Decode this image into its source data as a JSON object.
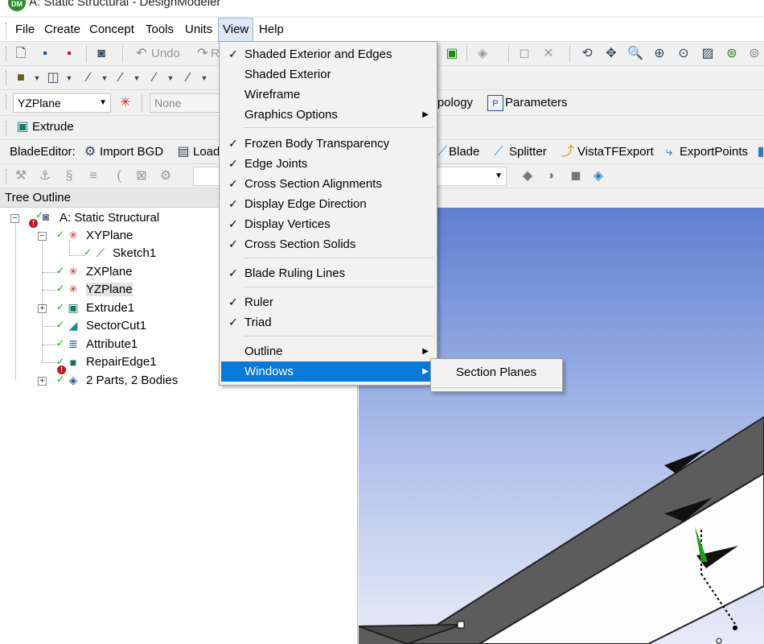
{
  "window": {
    "title": "A: Static Structural - DesignModeler",
    "app_icon": "designmodeler-icon"
  },
  "menubar": {
    "items": [
      "File",
      "Create",
      "Concept",
      "Tools",
      "Units",
      "View",
      "Help"
    ],
    "active": "View"
  },
  "toolbar1": {
    "undo_label": "Undo",
    "redo_label": "Re"
  },
  "toolbar3": {
    "plane_value": "YZPlane",
    "sketch_value": "None",
    "topology_label": "Topology",
    "parameters_label": "Parameters"
  },
  "toolbar4": {
    "extrude_label": "Extrude"
  },
  "toolbar5": {
    "bladeeditor_label": "BladeEditor:",
    "import_bgd_label": "Import BGD",
    "load_label": "Load",
    "blade_label": "Blade",
    "splitter_label": "Splitter",
    "vistatf_label": "VistaTFExport",
    "exportpoints_label": "ExportPoints"
  },
  "tree": {
    "header": "Tree Outline",
    "nodes": {
      "root": "A: Static Structural",
      "xyplane": "XYPlane",
      "sketch1": "Sketch1",
      "zxplane": "ZXPlane",
      "yzplane": "YZPlane",
      "extrude1": "Extrude1",
      "sectorcut1": "SectorCut1",
      "attribute1": "Attribute1",
      "repairedge1": "RepairEdge1",
      "parts": "2 Parts, 2 Bodies"
    }
  },
  "view_menu": {
    "items": [
      {
        "label": "Shaded Exterior and Edges",
        "checked": true
      },
      {
        "label": "Shaded Exterior",
        "checked": false
      },
      {
        "label": "Wireframe",
        "checked": false
      },
      {
        "label": "Graphics Options",
        "checked": false,
        "submenu": true
      },
      {
        "label": "Frozen Body Transparency",
        "checked": true
      },
      {
        "label": "Edge Joints",
        "checked": true
      },
      {
        "label": "Cross Section Alignments",
        "checked": true
      },
      {
        "label": "Display Edge Direction",
        "checked": true
      },
      {
        "label": "Display Vertices",
        "checked": true
      },
      {
        "label": "Cross Section Solids",
        "checked": true
      },
      {
        "label": "Blade Ruling Lines",
        "checked": true
      },
      {
        "label": "Ruler",
        "checked": true
      },
      {
        "label": "Triad",
        "checked": true
      },
      {
        "label": "Outline",
        "checked": false,
        "submenu": true
      },
      {
        "label": "Windows",
        "checked": false,
        "submenu": true,
        "highlighted": true
      }
    ],
    "check_glyph": "✓",
    "submenu_glyph": "▶"
  },
  "windows_submenu": {
    "items": [
      "Section Planes"
    ]
  },
  "colors": {
    "highlight": "#0a78d7",
    "check_green": "#1aa01a",
    "error_red": "#c0141c",
    "viewport_top": "#5f7fcf"
  }
}
